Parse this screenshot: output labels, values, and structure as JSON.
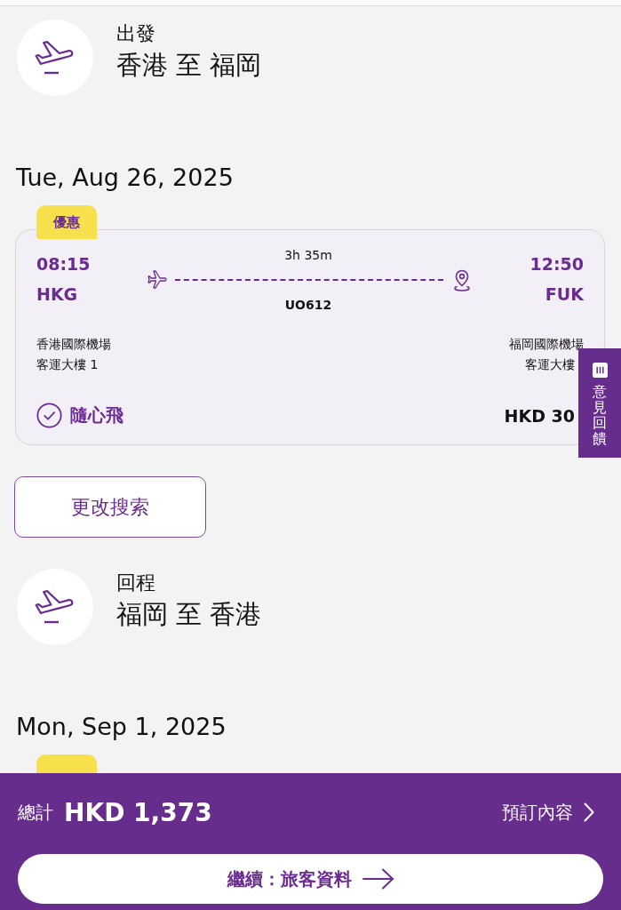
{
  "trips": [
    {
      "label": "出發",
      "route": "香港 至 福岡",
      "date": "Tue, Aug 26, 2025",
      "flights": [
        {
          "kind": "card",
          "badge": "優惠",
          "depart_time": "08:15",
          "depart_code": "HKG",
          "duration": "3h 35m",
          "flight_number": "UO612",
          "arrive_time": "12:50",
          "arrive_code": "FUK",
          "depart_airport": "香港國際機場",
          "depart_terminal": "客運大樓 1",
          "arrive_airport": "福岡國際機場",
          "arrive_terminal": "客運大樓",
          "fare": "隨心飛",
          "price": "HKD 30"
        }
      ],
      "change_search_button": "更改搜索"
    },
    {
      "label": "回程",
      "route": "福岡 至 香港",
      "date": "Mon, Sep 1, 2025",
      "flights": [
        {
          "kind": "badge_edge"
        }
      ]
    }
  ],
  "feedback_tab": {
    "label": "意見回饋"
  },
  "summary_bar": {
    "total_label": "總計",
    "total": "HKD 1,373",
    "details_link": "預訂內容",
    "continue_button": "繼續：旅客資料"
  }
}
